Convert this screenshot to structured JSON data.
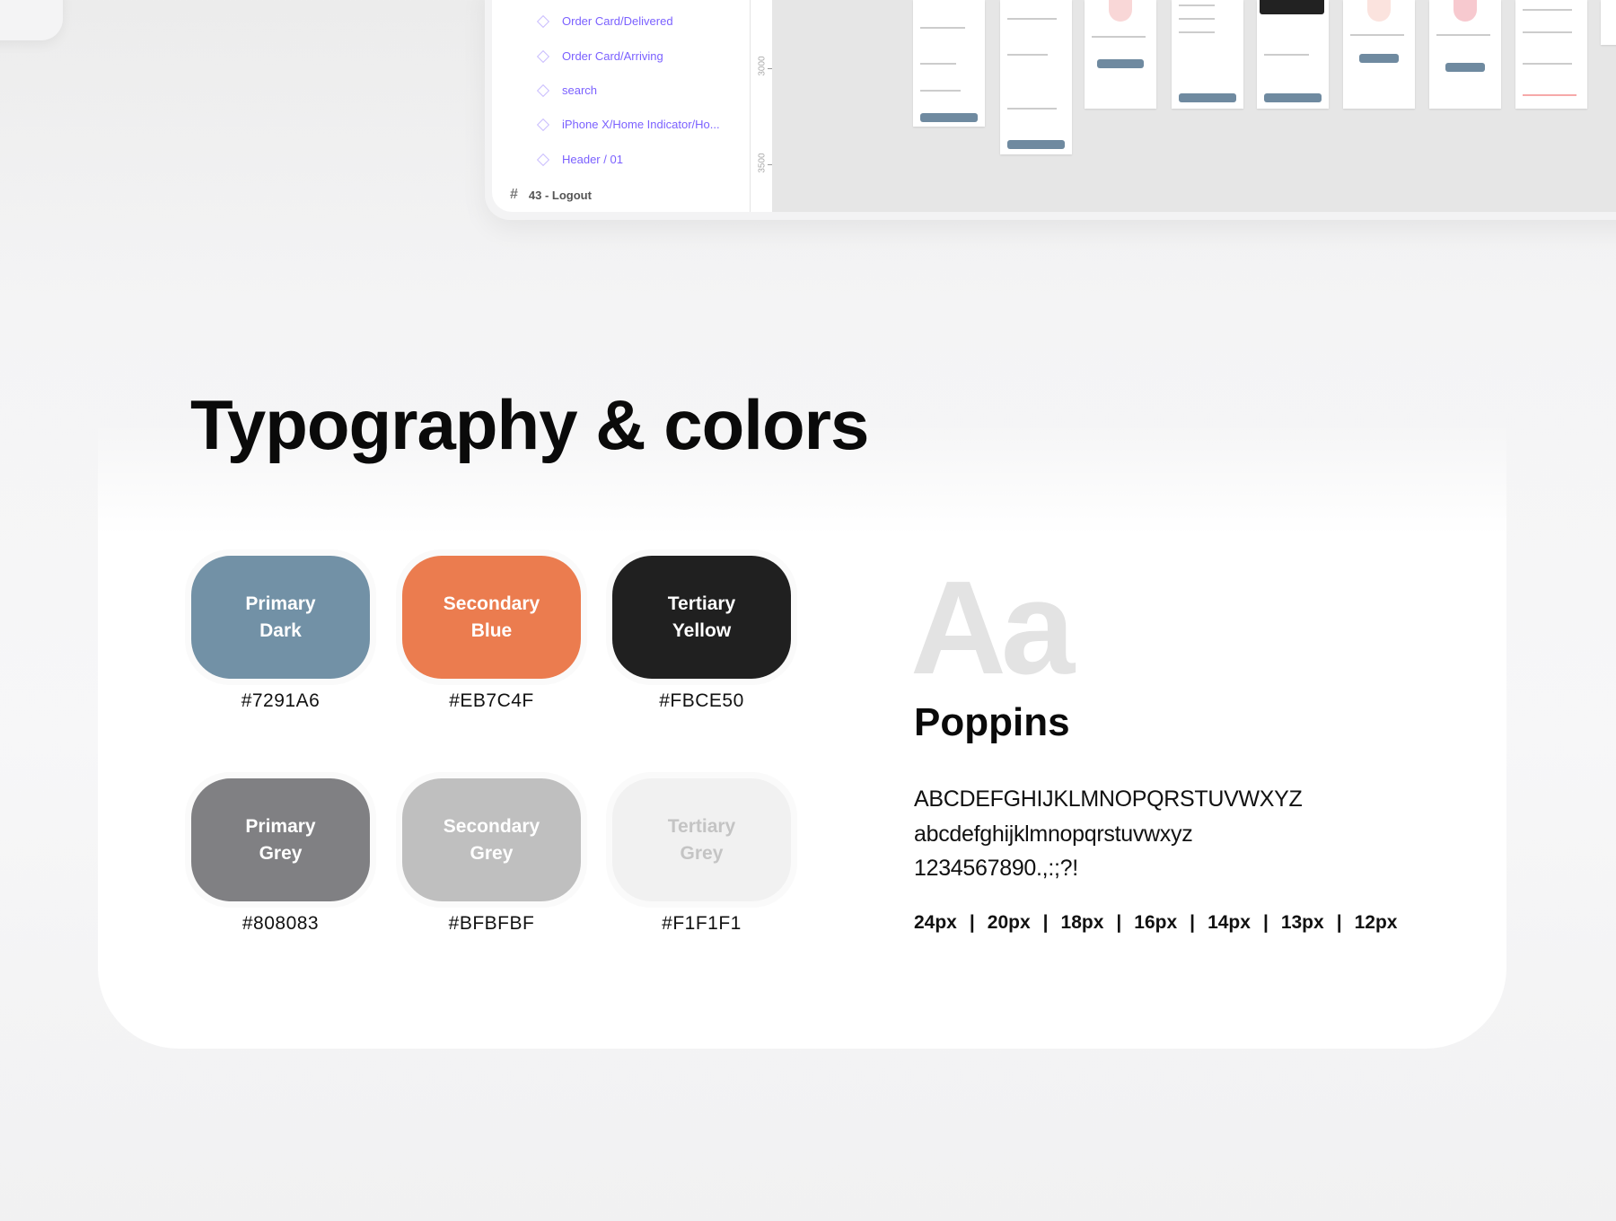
{
  "layers_panel": {
    "items": [
      {
        "label": "Order Card/Delivered",
        "icon": "component-diamond-icon"
      },
      {
        "label": "Order Card/Arriving",
        "icon": "component-diamond-icon"
      },
      {
        "label": "search",
        "icon": "component-diamond-icon"
      },
      {
        "label": "iPhone X/Home Indicator/Ho...",
        "icon": "component-diamond-icon"
      },
      {
        "label": "Header / 01",
        "icon": "component-diamond-icon"
      }
    ],
    "frame": {
      "label": "43 - Logout",
      "icon": "frame-hash-icon"
    }
  },
  "ruler": {
    "marks": [
      "3000",
      "3500"
    ]
  },
  "section": {
    "title": "Typography & colors"
  },
  "colors": [
    {
      "name": "Primary\nDark",
      "hex": "#7291A6",
      "swatch": "#7291A6",
      "text_color": "#ffffff"
    },
    {
      "name": "Secondary\nBlue",
      "hex": "#EB7C4F",
      "swatch": "#EB7C4F",
      "text_color": "#ffffff"
    },
    {
      "name": "Tertiary\nYellow",
      "hex": "#FBCE50",
      "swatch": "#202020",
      "text_color": "#ffffff"
    },
    {
      "name": "Primary\nGrey",
      "hex": "#808083",
      "swatch": "#808083",
      "text_color": "#ffffff"
    },
    {
      "name": "Secondary\nGrey",
      "hex": "#BFBFBF",
      "swatch": "#BFBFBF",
      "text_color": "#ffffff"
    },
    {
      "name": "Tertiary\nGrey",
      "hex": "#F1F1F1",
      "swatch": "#F1F1F1",
      "text_color": "#c4c4c4"
    }
  ],
  "typography": {
    "sample": "Aa",
    "font_name": "Poppins",
    "uppercase": "ABCDEFGHIJKLMNOPQRSTUVWXYZ",
    "lowercase": "abcdefghijklmnopqrstuvwxyz",
    "numerals": "1234567890.,:;?!",
    "sizes": [
      "24px",
      "20px",
      "18px",
      "16px",
      "14px",
      "13px",
      "12px"
    ],
    "separator": "|"
  }
}
